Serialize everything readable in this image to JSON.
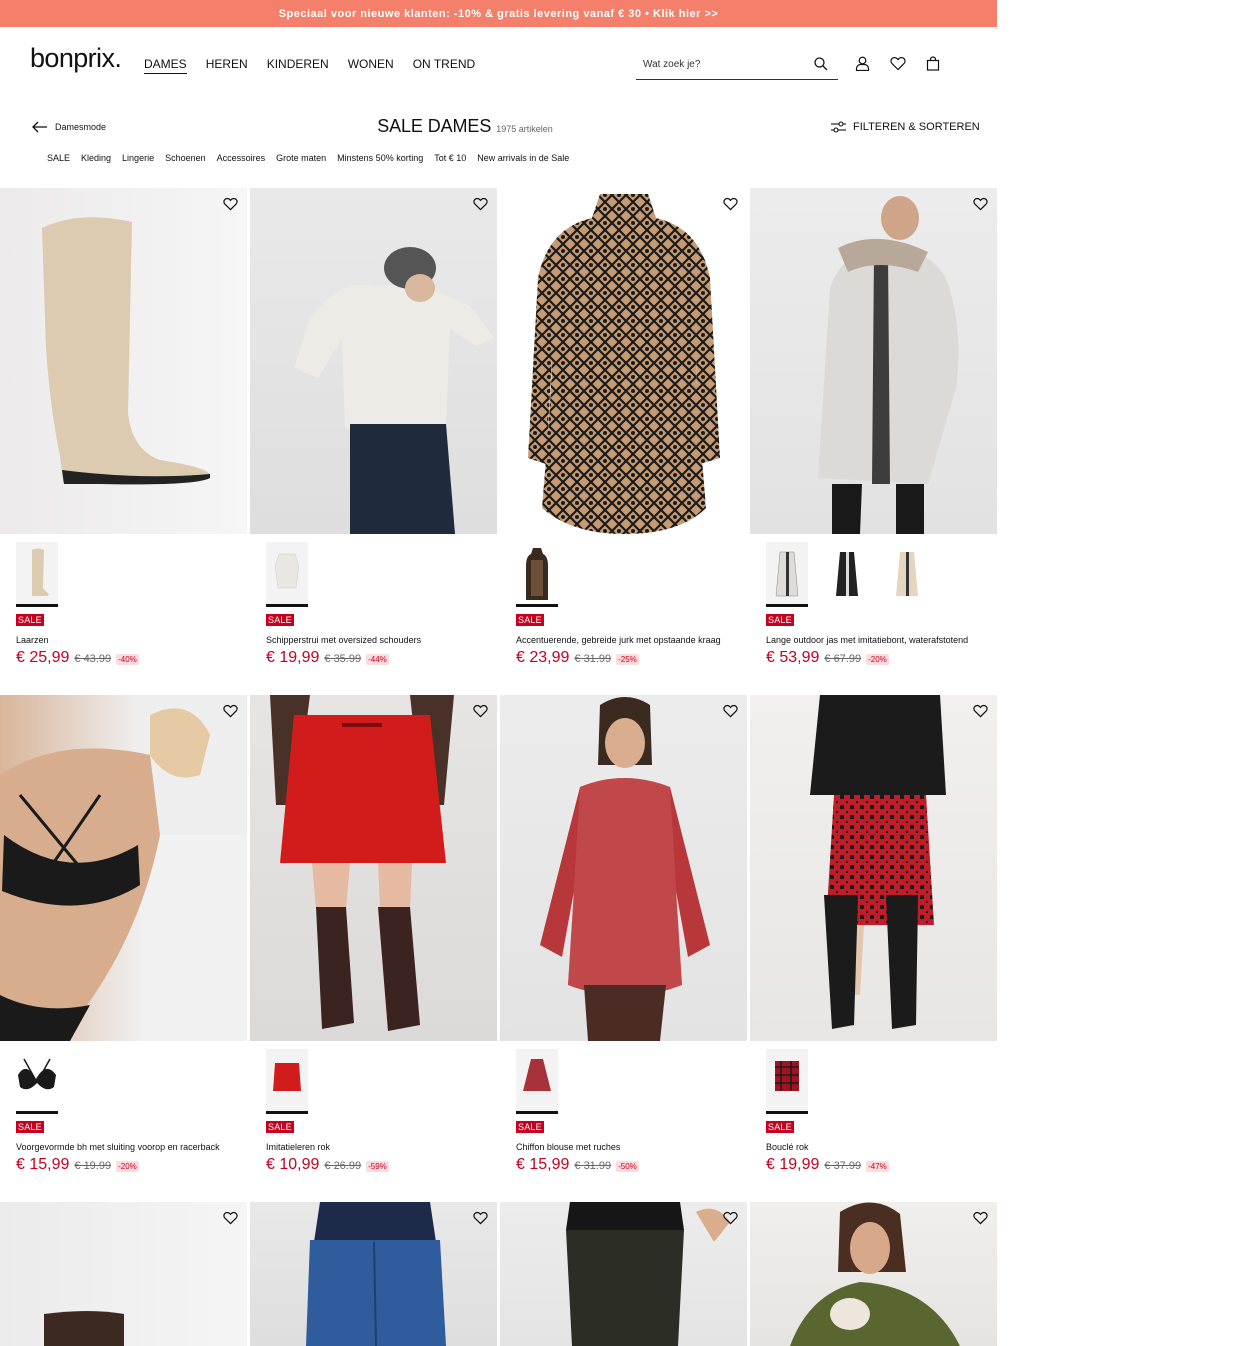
{
  "promo": {
    "text": "Speciaal voor nieuwe klanten: -10% & gratis levering vanaf € 30 • Klik hier >>"
  },
  "header": {
    "logo": "bonprix.",
    "nav": [
      "DAMES",
      "HEREN",
      "KINDEREN",
      "WONEN",
      "ON TREND"
    ],
    "search_placeholder": "Wat zoek je?"
  },
  "page": {
    "back_label": "Damesmode",
    "title": "SALE DAMES",
    "count": "1975 artikelen",
    "filter_label": "FILTEREN & SORTEREN"
  },
  "subnav": [
    "SALE",
    "Kleding",
    "Lingerie",
    "Schoenen",
    "Accessoires",
    "Grote maten",
    "Minstens 50% korting",
    "Tot € 10",
    "New arrivals in de Sale"
  ],
  "products": [
    {
      "name": "Laarzen",
      "price": "€ 25,99",
      "old": "€ 43.99",
      "discount": "-40%",
      "badge": "SALE"
    },
    {
      "name": "Schipperstrui met oversized schouders",
      "price": "€ 19,99",
      "old": "€ 35.99",
      "discount": "-44%",
      "badge": "SALE"
    },
    {
      "name": "Accentuerende, gebreide jurk met opstaande kraag",
      "price": "€ 23,99",
      "old": "€ 31.99",
      "discount": "-25%",
      "badge": "SALE"
    },
    {
      "name": "Lange outdoor jas met imitatiebont, waterafstotend",
      "price": "€ 53,99",
      "old": "€ 67.99",
      "discount": "-20%",
      "badge": "SALE"
    },
    {
      "name": "Voorgevormde bh met sluiting voorop en racerback",
      "price": "€ 15,99",
      "old": "€ 19.99",
      "discount": "-20%",
      "badge": "SALE"
    },
    {
      "name": "Imitatieleren rok",
      "price": "€ 10,99",
      "old": "€ 26.99",
      "discount": "-59%",
      "badge": "SALE"
    },
    {
      "name": "Chiffon blouse met ruches",
      "price": "€ 15,99",
      "old": "€ 31.99",
      "discount": "-50%",
      "badge": "SALE"
    },
    {
      "name": "Bouclé rok",
      "price": "€ 19,99",
      "old": "€ 37.99",
      "discount": "-47%",
      "badge": "SALE"
    }
  ],
  "colors": {
    "promo": "#f47f6b",
    "sale": "#c6001e"
  }
}
